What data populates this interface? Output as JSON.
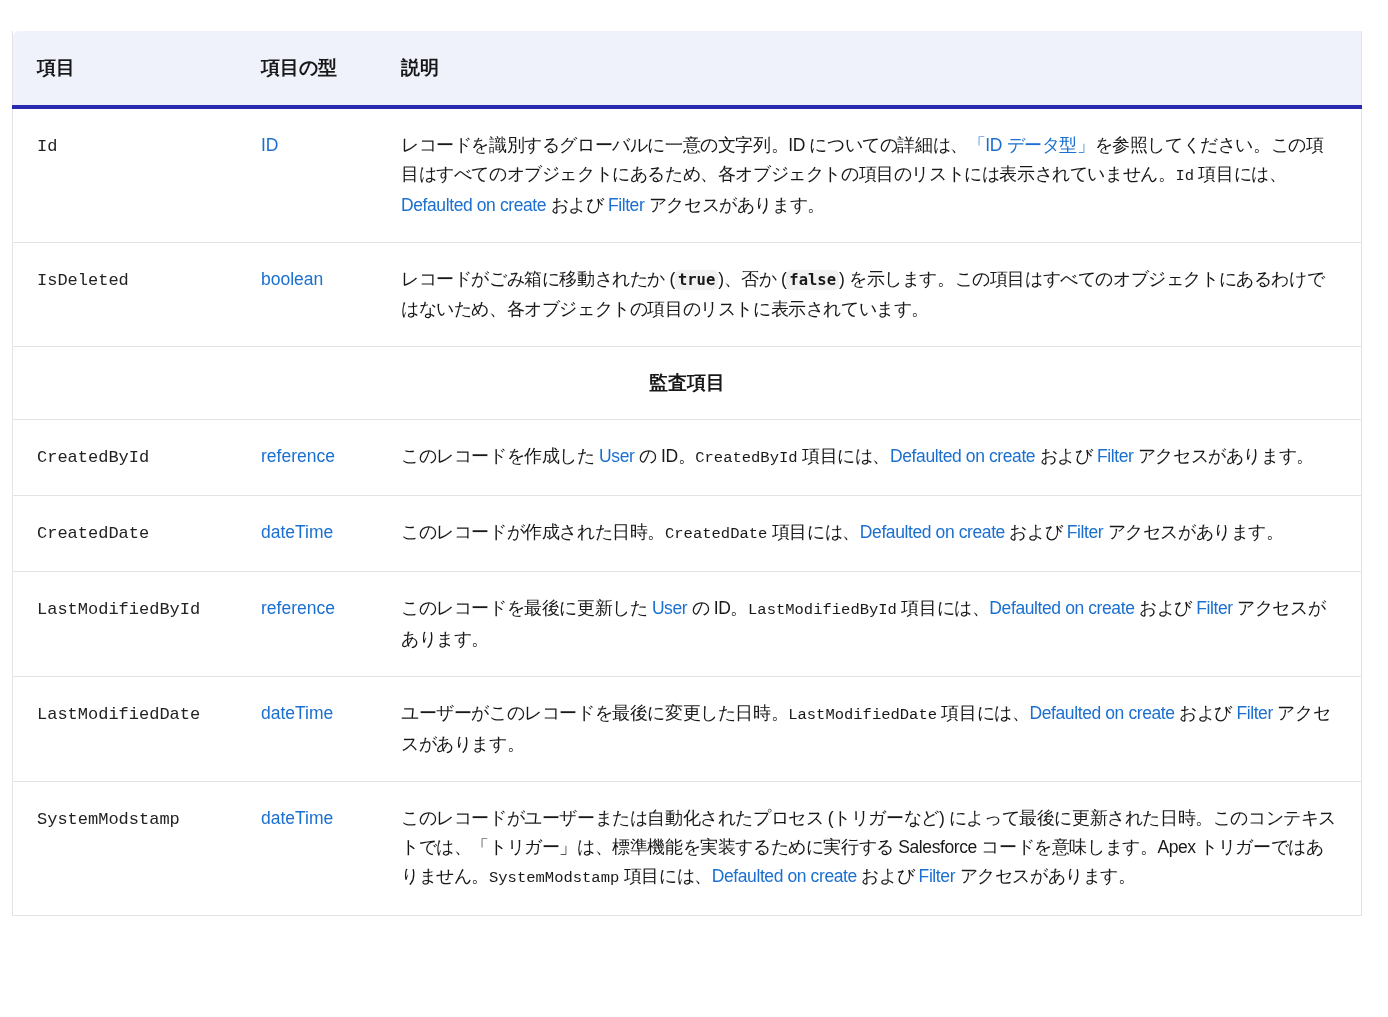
{
  "table": {
    "columns": [
      "項目",
      "項目の型",
      "説明"
    ],
    "rows": [
      {
        "kind": "field",
        "name": "Id",
        "type": "ID",
        "description": [
          {
            "kind": "text",
            "text": "レコードを識別するグローバルに一意の文字列。ID についての詳細は、"
          },
          {
            "kind": "link",
            "text": "「ID データ型」"
          },
          {
            "kind": "text",
            "text": "を参照してください。この項目はすべてのオブジェクトにあるため、各オブジェクトの項目のリストには表示されていません。"
          },
          {
            "kind": "mono",
            "text": "Id"
          },
          {
            "kind": "text",
            "text": " 項目には、"
          },
          {
            "kind": "link",
            "text": "Defaulted on create"
          },
          {
            "kind": "text",
            "text": " および "
          },
          {
            "kind": "link",
            "text": "Filter"
          },
          {
            "kind": "text",
            "text": " アクセスがあります。"
          }
        ]
      },
      {
        "kind": "field",
        "name": "IsDeleted",
        "type": "boolean",
        "description": [
          {
            "kind": "text",
            "text": "レコードがごみ箱に移動されたか ("
          },
          {
            "kind": "code",
            "text": "true"
          },
          {
            "kind": "text",
            "text": ")、否か ("
          },
          {
            "kind": "code",
            "text": "false"
          },
          {
            "kind": "text",
            "text": ") を示します。この項目はすべてのオブジェクトにあるわけではないため、各オブジェクトの項目のリストに表示されています。"
          }
        ]
      },
      {
        "kind": "section",
        "title": "監査項目"
      },
      {
        "kind": "field",
        "name": "CreatedById",
        "type": "reference",
        "description": [
          {
            "kind": "text",
            "text": "このレコードを作成した "
          },
          {
            "kind": "link",
            "text": "User"
          },
          {
            "kind": "text",
            "text": " の ID。"
          },
          {
            "kind": "mono",
            "text": "CreatedById"
          },
          {
            "kind": "text",
            "text": " 項目には、"
          },
          {
            "kind": "link",
            "text": "Defaulted on create"
          },
          {
            "kind": "text",
            "text": " および "
          },
          {
            "kind": "link",
            "text": "Filter"
          },
          {
            "kind": "text",
            "text": " アクセスがあります。"
          }
        ]
      },
      {
        "kind": "field",
        "name": "CreatedDate",
        "type": "dateTime",
        "description": [
          {
            "kind": "text",
            "text": "このレコードが作成された日時。"
          },
          {
            "kind": "mono",
            "text": "CreatedDate"
          },
          {
            "kind": "text",
            "text": " 項目には、"
          },
          {
            "kind": "link",
            "text": "Defaulted on create"
          },
          {
            "kind": "text",
            "text": " および "
          },
          {
            "kind": "link",
            "text": "Filter"
          },
          {
            "kind": "text",
            "text": " アクセスがあります。"
          }
        ]
      },
      {
        "kind": "field",
        "name": "LastModifiedById",
        "type": "reference",
        "description": [
          {
            "kind": "text",
            "text": "このレコードを最後に更新した "
          },
          {
            "kind": "link",
            "text": "User"
          },
          {
            "kind": "text",
            "text": " の ID。"
          },
          {
            "kind": "mono",
            "text": "LastModifiedById"
          },
          {
            "kind": "text",
            "text": " 項目には、"
          },
          {
            "kind": "link",
            "text": "Defaulted on create"
          },
          {
            "kind": "text",
            "text": " および "
          },
          {
            "kind": "link",
            "text": "Filter"
          },
          {
            "kind": "text",
            "text": " アクセスがあります。"
          }
        ]
      },
      {
        "kind": "field",
        "name": "LastModifiedDate",
        "type": "dateTime",
        "description": [
          {
            "kind": "text",
            "text": "ユーザーがこのレコードを最後に変更した日時。"
          },
          {
            "kind": "mono",
            "text": "LastModifiedDate"
          },
          {
            "kind": "text",
            "text": " 項目には、"
          },
          {
            "kind": "link",
            "text": "Defaulted on create"
          },
          {
            "kind": "text",
            "text": " および "
          },
          {
            "kind": "link",
            "text": "Filter"
          },
          {
            "kind": "text",
            "text": " アクセスがあります。"
          }
        ]
      },
      {
        "kind": "field",
        "name": "SystemModstamp",
        "type": "dateTime",
        "description": [
          {
            "kind": "text",
            "text": "このレコードがユーザーまたは自動化されたプロセス (トリガーなど) によって最後に更新された日時。このコンテキストでは、「トリガー」は、標準機能を実装するために実行する Salesforce コードを意味します。Apex トリガーではありません。"
          },
          {
            "kind": "mono",
            "text": "SystemModstamp"
          },
          {
            "kind": "text",
            "text": " 項目には、"
          },
          {
            "kind": "link",
            "text": "Defaulted on create"
          },
          {
            "kind": "text",
            "text": " および "
          },
          {
            "kind": "link",
            "text": "Filter"
          },
          {
            "kind": "text",
            "text": " アクセスがあります。"
          }
        ]
      }
    ]
  }
}
